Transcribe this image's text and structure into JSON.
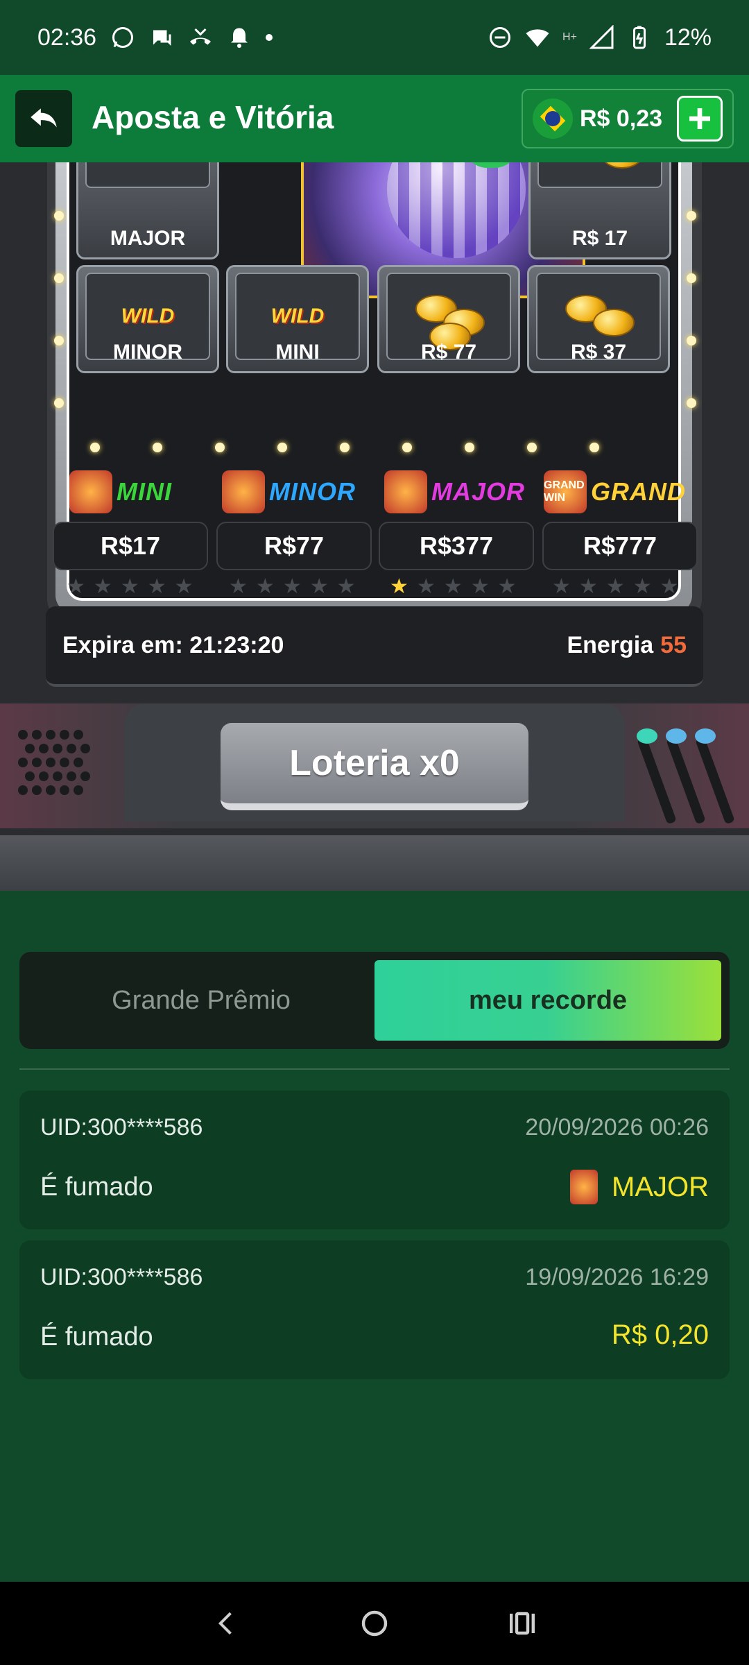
{
  "status_bar": {
    "time": "02:36",
    "network": "H+",
    "battery": "12%"
  },
  "header": {
    "title": "Aposta e Vitória",
    "balance": "R$ 0,23"
  },
  "reels": {
    "top_row": [
      {
        "label": "MAJOR",
        "icon": "wild-cat-icon"
      },
      {
        "label": "R$ 17",
        "icon": "gold-coins-icon"
      }
    ],
    "bottom_row": [
      {
        "label": "MINOR",
        "icon": "wild-rabbit-icon"
      },
      {
        "label": "MINI",
        "icon": "wild-dragon-icon"
      },
      {
        "label": "R$ 77",
        "icon": "gold-coins-icon"
      },
      {
        "label": "R$ 37",
        "icon": "gold-coins-icon"
      }
    ],
    "wild_text": "WILD"
  },
  "jackpots": [
    {
      "name": "MINI",
      "value": "R$17",
      "stars_on": 0,
      "stars_total": 5,
      "color": "#3bd63b"
    },
    {
      "name": "MINOR",
      "value": "R$77",
      "stars_on": 0,
      "stars_total": 5,
      "color": "#2ea8ff"
    },
    {
      "name": "MAJOR",
      "value": "R$377",
      "stars_on": 1,
      "stars_total": 5,
      "color": "#e23ce0"
    },
    {
      "name": "GRAND",
      "value": "R$777",
      "stars_on": 0,
      "stars_total": 5,
      "color": "#ffd23a",
      "badge": "GRAND WIN"
    }
  ],
  "info": {
    "expires_label": "Expira em: 21:23:20",
    "energy_label": "Energia",
    "energy_value": "55"
  },
  "lottery_button": "Loteria x0",
  "tabs": [
    {
      "label": "Grande Prêmio",
      "active": false
    },
    {
      "label": "meu recorde",
      "active": true
    }
  ],
  "records": [
    {
      "uid": "UID:300****586",
      "date": "20/09/2026 00:26",
      "label": "É fumado",
      "prize": "MAJOR",
      "prize_icon": "major-wild-icon"
    },
    {
      "uid": "UID:300****586",
      "date": "19/09/2026 16:29",
      "label": "É fumado",
      "prize": "R$ 0,20"
    }
  ],
  "colors": {
    "background": "#114a2a",
    "header": "#0d7c3a",
    "prize_text": "#f4e52c",
    "energy": "#f36b3b",
    "tab_active_start": "#2fd09a",
    "tab_active_end": "#9be03a"
  }
}
